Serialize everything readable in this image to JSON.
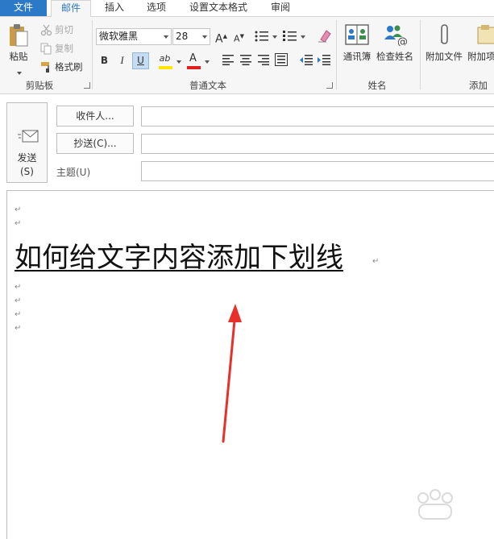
{
  "tabs": {
    "file": "文件",
    "mail": "邮件",
    "insert": "插入",
    "options": "选项",
    "format_text": "设置文本格式",
    "review": "审阅"
  },
  "ribbon": {
    "clipboard": {
      "paste": "粘贴",
      "cut": "剪切",
      "copy": "复制",
      "format_painter": "格式刷",
      "group_label": "剪贴板"
    },
    "basic_text": {
      "font_name": "微软雅黑",
      "font_size": "28",
      "bold": "B",
      "italic": "I",
      "underline": "U",
      "grow_font": "A",
      "shrink_font": "A",
      "font_color": "A",
      "highlight": "ab",
      "group_label": "普通文本"
    },
    "names": {
      "address_book": "通讯簿",
      "check_names": "检查姓名",
      "group_label": "姓名"
    },
    "include": {
      "attach_file": "附加文件",
      "attach_item": "附加项",
      "group_label": "添加"
    }
  },
  "compose": {
    "send_line1": "发送",
    "send_line2": "(S)",
    "to_button": "收件人...",
    "cc_button": "抄送(C)...",
    "subject_label": "主题(U)",
    "to_value": "",
    "cc_value": "",
    "subject_value": ""
  },
  "body": {
    "para_mark": "↵",
    "headline": "如何给文字内容添加下划线"
  },
  "colors": {
    "accent": "#2b79c7",
    "highlight_yellow": "#ffe600",
    "font_red": "#e02020",
    "arrow_red": "#e8302a"
  }
}
